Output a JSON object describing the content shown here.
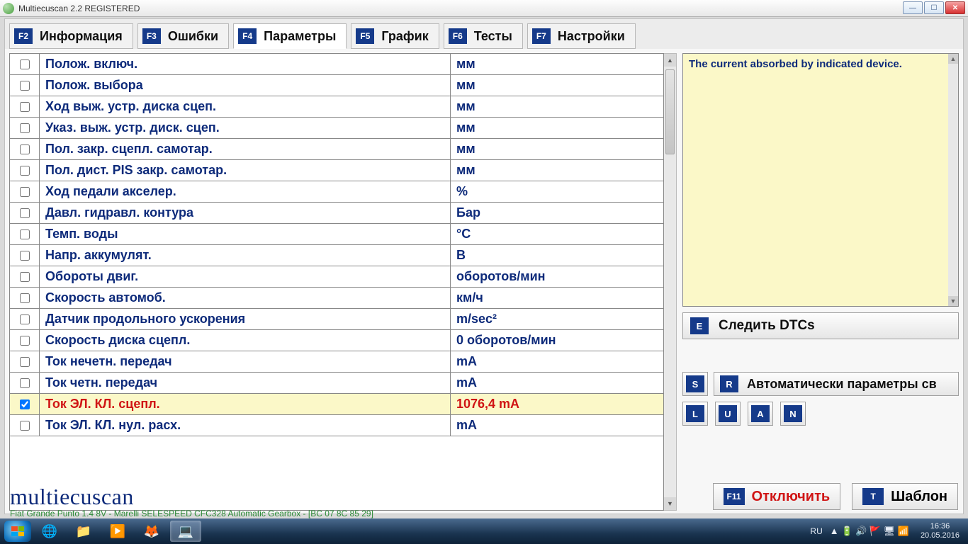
{
  "window": {
    "title": "Multiecuscan 2.2 REGISTERED"
  },
  "tabs": [
    {
      "key": "F2",
      "label": "Информация"
    },
    {
      "key": "F3",
      "label": "Ошибки"
    },
    {
      "key": "F4",
      "label": "Параметры"
    },
    {
      "key": "F5",
      "label": "График"
    },
    {
      "key": "F6",
      "label": "Тесты"
    },
    {
      "key": "F7",
      "label": "Настройки"
    }
  ],
  "active_tab": 2,
  "params": [
    {
      "checked": false,
      "name": "Полож. включ.",
      "value": "мм"
    },
    {
      "checked": false,
      "name": "Полож. выбора",
      "value": "мм"
    },
    {
      "checked": false,
      "name": "Ход выж. устр. диска сцеп.",
      "value": "мм"
    },
    {
      "checked": false,
      "name": "Указ. выж. устр. диск. сцеп.",
      "value": "мм"
    },
    {
      "checked": false,
      "name": "Пол. закр. сцепл. самотар.",
      "value": "мм"
    },
    {
      "checked": false,
      "name": "Пол. дист. PIS закр. самотар.",
      "value": "мм"
    },
    {
      "checked": false,
      "name": "Ход педали акселер.",
      "value": "%"
    },
    {
      "checked": false,
      "name": "Давл. гидравл. контура",
      "value": "Бар"
    },
    {
      "checked": false,
      "name": "Темп. воды",
      "value": "°C"
    },
    {
      "checked": false,
      "name": "Напр. аккумулят.",
      "value": "В"
    },
    {
      "checked": false,
      "name": "Обороты двиг.",
      "value": "оборотов/мин"
    },
    {
      "checked": false,
      "name": "Скорость автомоб.",
      "value": "км/ч"
    },
    {
      "checked": false,
      "name": "Датчик продольного ускорения",
      "value": "m/sec²"
    },
    {
      "checked": false,
      "name": "Скорость диска сцепл.",
      "value": "0 оборотов/мин"
    },
    {
      "checked": false,
      "name": "Ток нечетн. передач",
      "value": "mA"
    },
    {
      "checked": false,
      "name": "Ток четн. передач",
      "value": "mA"
    },
    {
      "checked": true,
      "name": "Ток ЭЛ. КЛ. сцепл.",
      "value": "1076,4 mA"
    },
    {
      "checked": false,
      "name": "Ток ЭЛ. КЛ. нул. расх.",
      "value": "mA"
    }
  ],
  "info_text": "The current absorbed by indicated device.",
  "dtc_btn": {
    "key": "E",
    "label": "Следить DTCs"
  },
  "auto_bar": {
    "s_key": "S",
    "r_key": "R",
    "label": "Автоматически параметры св"
  },
  "luan": [
    "L",
    "U",
    "A",
    "N"
  ],
  "logo": "multiecuscan",
  "footer_btns": {
    "disconnect": {
      "key": "F11",
      "label": "Отключить"
    },
    "template": {
      "key": "T",
      "label": "Шаблон"
    }
  },
  "status_line": "Fiat Grande Punto 1.4 8V - Marelli SELESPEED CFC328 Automatic Gearbox - [BC 07 8C 85 29]",
  "tray": {
    "lang": "RU",
    "time": "16:36",
    "date": "20.05.2016"
  }
}
